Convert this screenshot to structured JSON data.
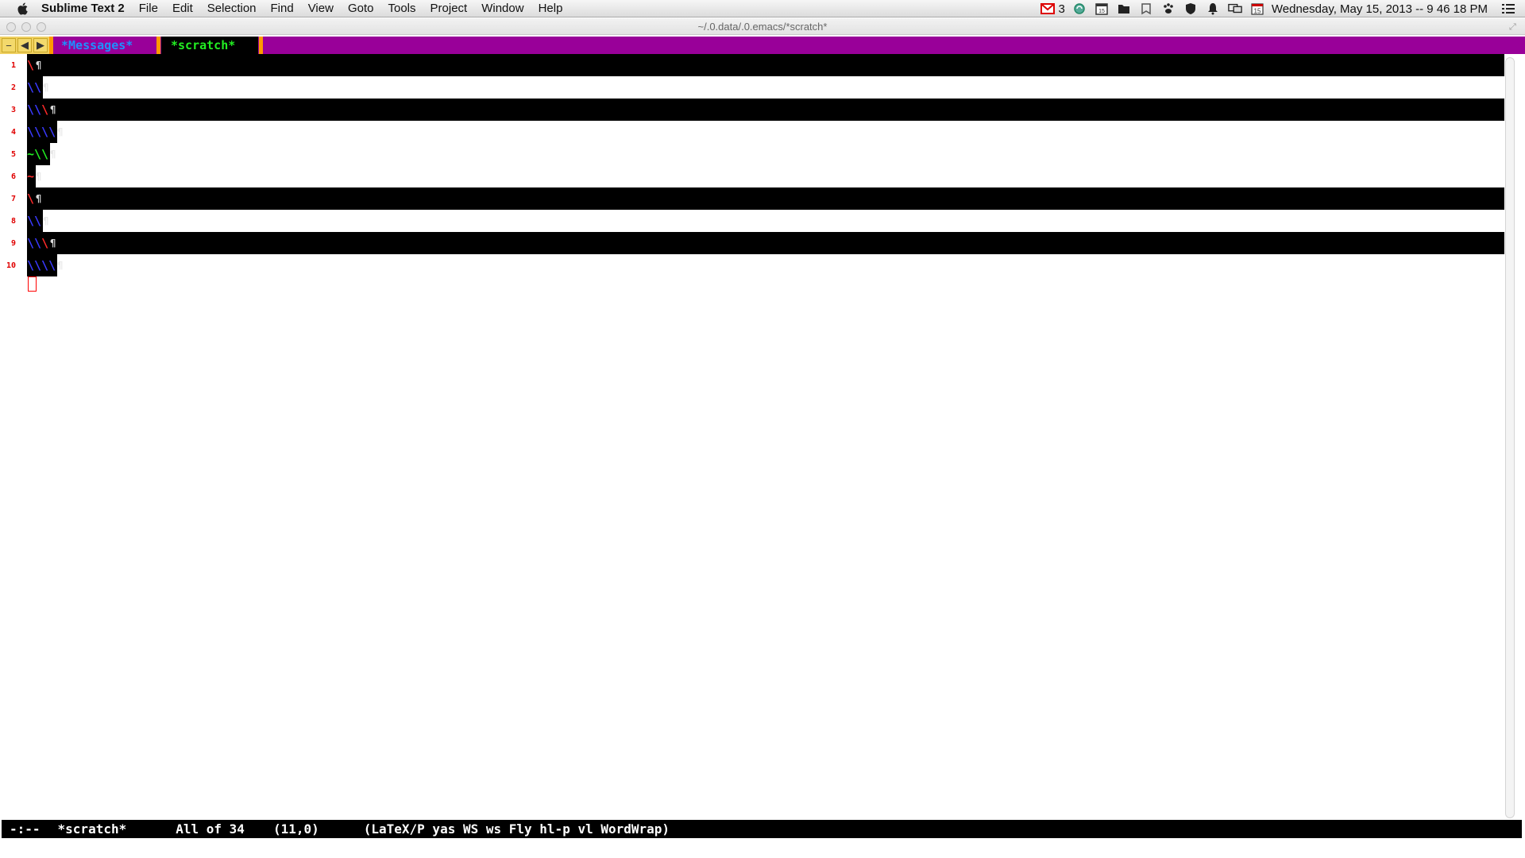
{
  "menubar": {
    "app_name": "Sublime Text 2",
    "items": [
      "File",
      "Edit",
      "Selection",
      "Find",
      "View",
      "Goto",
      "Tools",
      "Project",
      "Window",
      "Help"
    ],
    "mail_count": "3",
    "calendar_day": "15",
    "clock": "Wednesday, May 15, 2013 -- 9 46 18 PM",
    "icons": [
      "mail-icon",
      "sync-icon",
      "calendar-icon",
      "folder-icon",
      "bookmark-icon",
      "paw-icon",
      "shield-icon",
      "bell-icon",
      "display-icon",
      "calendar-icon",
      "list-icon"
    ]
  },
  "window": {
    "title": "~/.0.data/.0.emacs/*scratch*"
  },
  "tabbar": {
    "nav_buttons": [
      "−",
      "◀",
      "▶"
    ],
    "tabs": [
      {
        "label": "*Messages*",
        "color": "#1e90ff"
      },
      {
        "label": "*scratch*",
        "color": "#22ee22",
        "active": true
      }
    ],
    "background": "#990099",
    "separator_color": "#ff9900"
  },
  "editor": {
    "lines": [
      {
        "num": "1",
        "segments": [
          {
            "text": "\\",
            "color": "red"
          }
        ],
        "eol": "¶",
        "band": true
      },
      {
        "num": "2",
        "segments": [
          {
            "text": "\\\\",
            "color": "blue"
          }
        ],
        "eol": "¶",
        "band": false
      },
      {
        "num": "3",
        "segments": [
          {
            "text": "\\\\",
            "color": "blue"
          },
          {
            "text": "\\",
            "color": "red"
          }
        ],
        "eol": "¶",
        "band": true
      },
      {
        "num": "4",
        "segments": [
          {
            "text": "\\\\\\\\",
            "color": "blue"
          }
        ],
        "eol": "¶",
        "band": false
      },
      {
        "num": "5",
        "segments": [
          {
            "text": "~\\\\",
            "color": "green"
          }
        ],
        "eol": "¶",
        "band": false
      },
      {
        "num": "6",
        "segments": [
          {
            "text": "~",
            "color": "red"
          }
        ],
        "eol": "¶",
        "band": false
      },
      {
        "num": "7",
        "segments": [
          {
            "text": "\\",
            "color": "red"
          }
        ],
        "eol": "¶",
        "band": true
      },
      {
        "num": "8",
        "segments": [
          {
            "text": "\\\\",
            "color": "blue"
          }
        ],
        "eol": "¶",
        "band": false
      },
      {
        "num": "9",
        "segments": [
          {
            "text": "\\\\",
            "color": "blue"
          },
          {
            "text": "\\",
            "color": "red"
          }
        ],
        "eol": "¶",
        "band": true
      },
      {
        "num": "10",
        "segments": [
          {
            "text": "\\\\\\\\",
            "color": "blue"
          }
        ],
        "eol": "¶",
        "band": false
      }
    ]
  },
  "modeline": {
    "status": "-:--",
    "buffer": "*scratch*",
    "position": "All of 34",
    "cursor": "(11,0)",
    "modes": "(LaTeX/P yas WS ws Fly hl-p vl WordWrap)"
  }
}
